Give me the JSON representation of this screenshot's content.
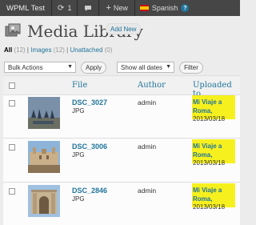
{
  "admin_bar": {
    "site": "WPML Test",
    "updates_count": "1",
    "new_label": "New",
    "language": "Spanish"
  },
  "header": {
    "title": "Media Library",
    "add_new": "Add New"
  },
  "filters": {
    "all": "All",
    "all_count": "(12)",
    "images": "Images",
    "images_count": "(12)",
    "unattached": "Unattached",
    "unattached_count": "(0)",
    "bulk_actions": "Bulk Actions",
    "apply": "Apply",
    "dates": "Show all dates",
    "filter": "Filter"
  },
  "table": {
    "columns": [
      "File",
      "Author",
      "Uploaded to"
    ],
    "rows": [
      {
        "file": "DSC_3027",
        "type": "JPG",
        "author": "admin",
        "uploaded_to": "Mi Viaje a Roma",
        "date": "2013/03/18"
      },
      {
        "file": "DSC_3006",
        "type": "JPG",
        "author": "admin",
        "uploaded_to": "Mi Viaje a Roma",
        "date": "2013/03/18"
      },
      {
        "file": "DSC_2846",
        "type": "JPG",
        "author": "admin",
        "uploaded_to": "Mi Viaje a Roma",
        "date": "2013/03/18"
      }
    ]
  },
  "colors": {
    "admin_bar": "#464646",
    "link": "#21759b",
    "highlight": "#f7f01f"
  }
}
